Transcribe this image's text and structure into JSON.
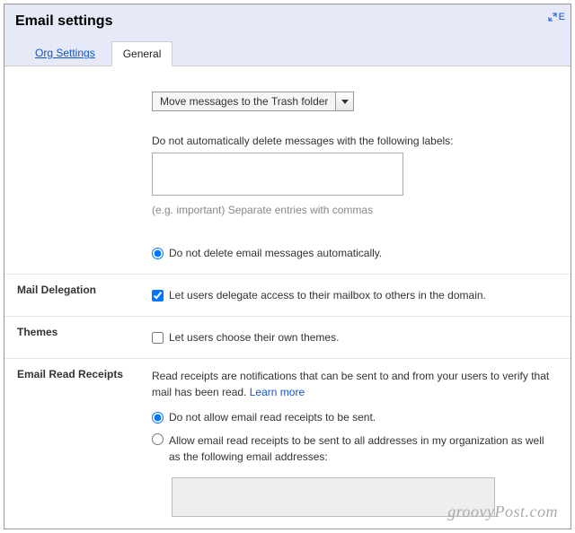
{
  "header": {
    "title": "Email settings",
    "expand_label": "E"
  },
  "tabs": {
    "org": "Org Settings",
    "general": "General"
  },
  "retention": {
    "dropdown_selected": "Move messages to the Trash folder",
    "labels_label": "Do not automatically delete messages with the following labels:",
    "labels_value": "",
    "labels_hint": "(e.g. important) Separate entries with commas",
    "no_delete_label": "Do not delete email messages automatically."
  },
  "delegation": {
    "title": "Mail Delegation",
    "checkbox_label": "Let users delegate access to their mailbox to others in the domain."
  },
  "themes": {
    "title": "Themes",
    "checkbox_label": "Let users choose their own themes."
  },
  "receipts": {
    "title": "Email Read Receipts",
    "description": "Read receipts are notifications that can be sent to and from your users to verify that mail has been read.",
    "learn_more": "Learn more",
    "opt_disallow": "Do not allow email read receipts to be sent.",
    "opt_allow": "Allow email read receipts to be sent to all addresses in my organization as well as the following email addresses:",
    "addresses_value": ""
  },
  "watermark": "groovyPost.com"
}
